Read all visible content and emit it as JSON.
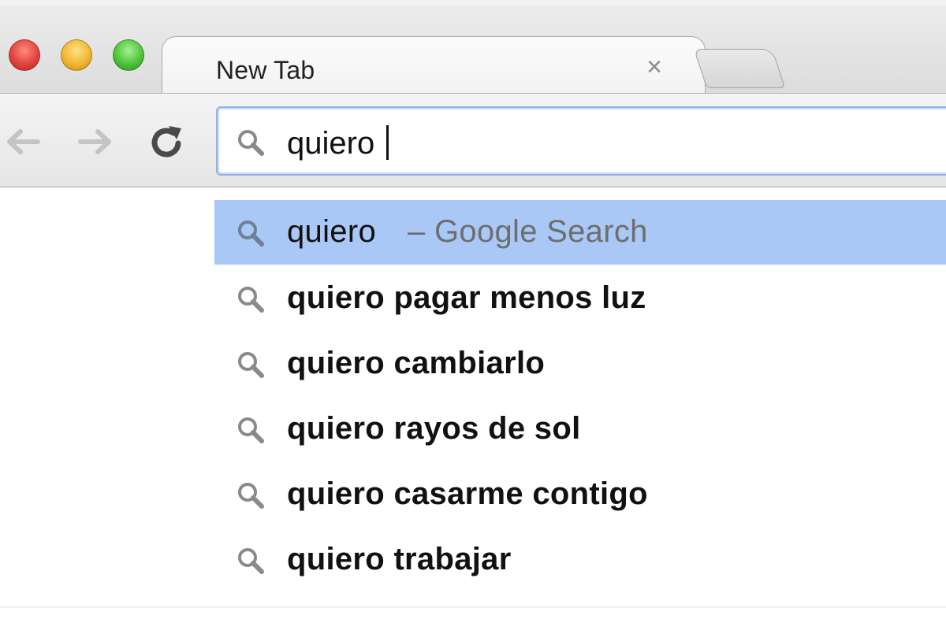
{
  "window": {
    "controls": [
      "close",
      "minimize",
      "maximize"
    ]
  },
  "tabs": [
    {
      "title": "New Tab",
      "close_glyph": "×",
      "active": true
    }
  ],
  "toolbar": {
    "back_icon": "back-arrow-icon",
    "forward_icon": "forward-arrow-icon",
    "reload_icon": "reload-icon"
  },
  "omnibox": {
    "icon": "search-icon",
    "value": "quiero "
  },
  "suggestions": [
    {
      "query": "quiero",
      "hint": "– Google Search",
      "selected": true,
      "bold": false
    },
    {
      "query": "quiero pagar menos luz",
      "selected": false,
      "bold": true
    },
    {
      "query": "quiero cambiarlo",
      "selected": false,
      "bold": true
    },
    {
      "query": "quiero rayos de sol",
      "selected": false,
      "bold": true
    },
    {
      "query": "quiero casarme contigo",
      "selected": false,
      "bold": true
    },
    {
      "query": "quiero trabajar",
      "selected": false,
      "bold": true
    }
  ],
  "colors": {
    "selection": "#a9c8f5",
    "focus_ring": "#8fb3e8",
    "close": "#e0443e",
    "minimize": "#f2b632",
    "maximize": "#4fc43b"
  }
}
